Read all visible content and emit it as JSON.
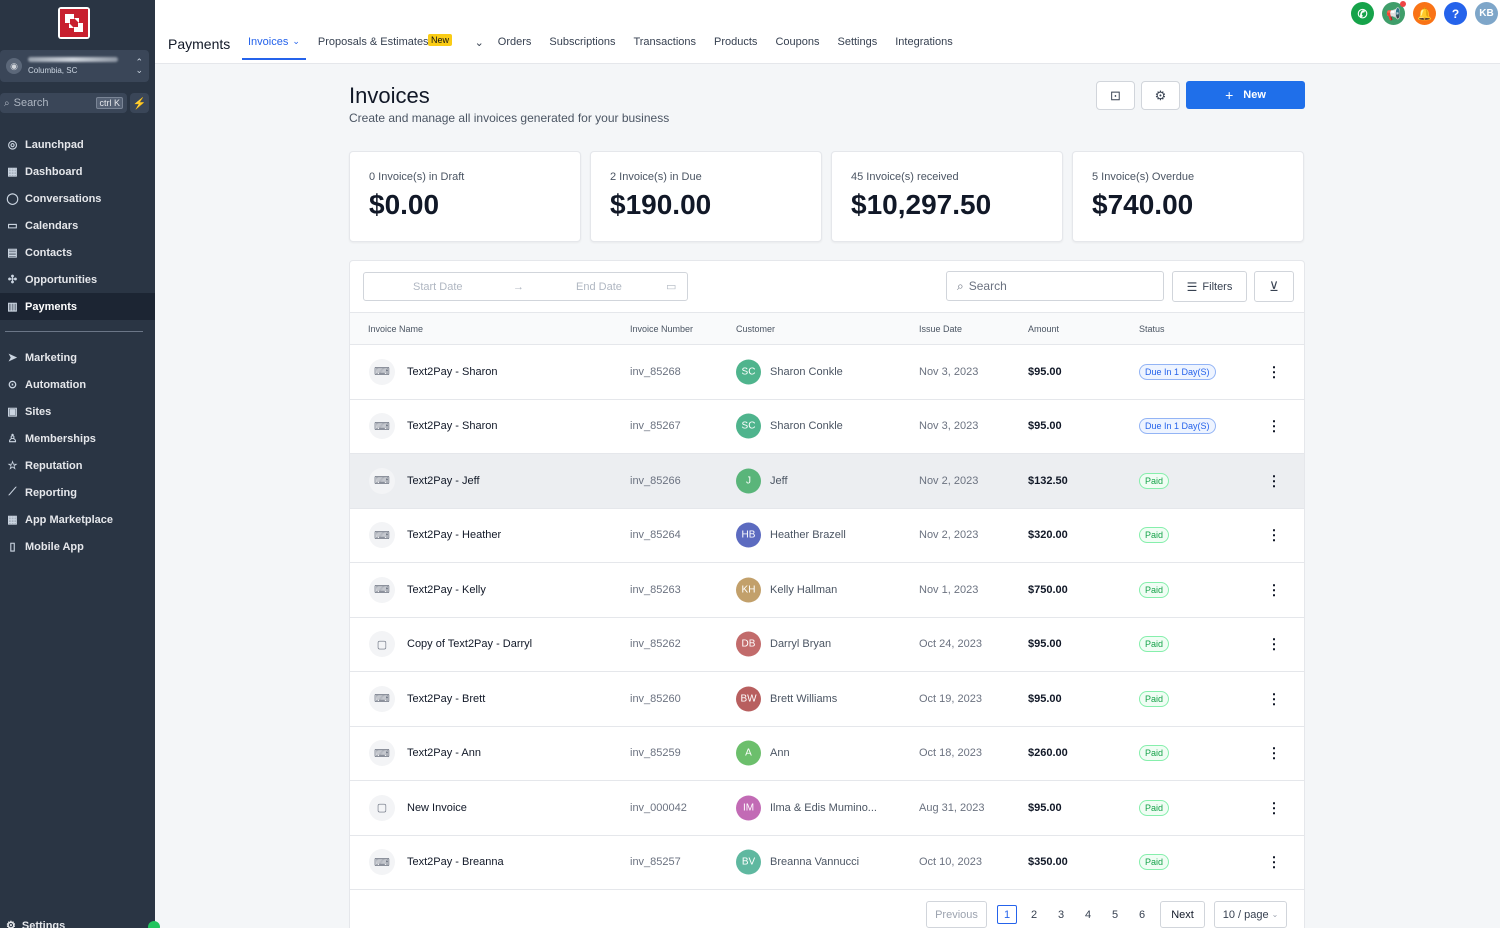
{
  "sidebar": {
    "account_location": "Columbia, SC",
    "search_placeholder": "Search",
    "search_shortcut": "ctrl K",
    "items": [
      {
        "label": "Launchpad",
        "icon": "launchpad-icon",
        "glyph": "◎"
      },
      {
        "label": "Dashboard",
        "icon": "dashboard-icon",
        "glyph": "▦"
      },
      {
        "label": "Conversations",
        "icon": "chat-icon",
        "glyph": "◯"
      },
      {
        "label": "Calendars",
        "icon": "calendar-icon",
        "glyph": "▭"
      },
      {
        "label": "Contacts",
        "icon": "contacts-icon",
        "glyph": "▤"
      },
      {
        "label": "Opportunities",
        "icon": "opportunities-icon",
        "glyph": "✣"
      },
      {
        "label": "Payments",
        "icon": "payments-icon",
        "glyph": "▥"
      }
    ],
    "items2": [
      {
        "label": "Marketing",
        "icon": "send-icon",
        "glyph": "➤"
      },
      {
        "label": "Automation",
        "icon": "automation-icon",
        "glyph": "⊙"
      },
      {
        "label": "Sites",
        "icon": "sites-icon",
        "glyph": "▣"
      },
      {
        "label": "Memberships",
        "icon": "memberships-icon",
        "glyph": "♙"
      },
      {
        "label": "Reputation",
        "icon": "star-icon",
        "glyph": "☆"
      },
      {
        "label": "Reporting",
        "icon": "chart-line-icon",
        "glyph": "⟋"
      },
      {
        "label": "App Marketplace",
        "icon": "grid-icon",
        "glyph": "▦"
      },
      {
        "label": "Mobile App",
        "icon": "mobile-icon",
        "glyph": "▯"
      }
    ],
    "settings_label": "Settings"
  },
  "topbar": {
    "section_title": "Payments",
    "tabs": [
      "Invoices",
      "Proposals & Estimates",
      "Orders",
      "Subscriptions",
      "Transactions",
      "Products",
      "Coupons",
      "Settings",
      "Integrations"
    ],
    "new_badge": "New",
    "user_initials": "KB"
  },
  "header": {
    "title": "Invoices",
    "subtitle": "Create and manage all invoices generated for your business",
    "new_button": "New"
  },
  "summary": [
    {
      "label": "0 Invoice(s) in Draft",
      "amount": "$0.00"
    },
    {
      "label": "2 Invoice(s) in Due",
      "amount": "$190.00"
    },
    {
      "label": "45 Invoice(s) received",
      "amount": "$10,297.50"
    },
    {
      "label": "5 Invoice(s) Overdue",
      "amount": "$740.00"
    }
  ],
  "filters": {
    "start_date": "Start Date",
    "end_date": "End Date",
    "search_placeholder": "Search",
    "filters_label": "Filters"
  },
  "table": {
    "columns": [
      "Invoice Name",
      "Invoice Number",
      "Customer",
      "Issue Date",
      "Amount",
      "Status"
    ],
    "rows": [
      {
        "name": "Text2Pay - Sharon",
        "number": "inv_85268",
        "initials": "SC",
        "avatar_color": "#4fb48d",
        "customer": "Sharon Conkle",
        "date": "Nov 3, 2023",
        "amount": "$95.00",
        "status": "Due In 1 Day(S)",
        "status_type": "due",
        "icon": "text2pay-icon"
      },
      {
        "name": "Text2Pay - Sharon",
        "number": "inv_85267",
        "initials": "SC",
        "avatar_color": "#4fb48d",
        "customer": "Sharon Conkle",
        "date": "Nov 3, 2023",
        "amount": "$95.00",
        "status": "Due In 1 Day(S)",
        "status_type": "due",
        "icon": "text2pay-icon"
      },
      {
        "name": "Text2Pay - Jeff",
        "number": "inv_85266",
        "initials": "J",
        "avatar_color": "#5ab57a",
        "customer": "Jeff",
        "date": "Nov 2, 2023",
        "amount": "$132.50",
        "status": "Paid",
        "status_type": "paid",
        "icon": "text2pay-icon"
      },
      {
        "name": "Text2Pay - Heather",
        "number": "inv_85264",
        "initials": "HB",
        "avatar_color": "#5c6bc0",
        "customer": "Heather Brazell",
        "date": "Nov 2, 2023",
        "amount": "$320.00",
        "status": "Paid",
        "status_type": "paid",
        "icon": "text2pay-icon"
      },
      {
        "name": "Text2Pay - Kelly",
        "number": "inv_85263",
        "initials": "KH",
        "avatar_color": "#c2a06b",
        "customer": "Kelly Hallman",
        "date": "Nov 1, 2023",
        "amount": "$750.00",
        "status": "Paid",
        "status_type": "paid",
        "icon": "text2pay-icon"
      },
      {
        "name": "Copy of Text2Pay - Darryl",
        "number": "inv_85262",
        "initials": "DB",
        "avatar_color": "#c26b6b",
        "customer": "Darryl Bryan",
        "date": "Oct 24, 2023",
        "amount": "$95.00",
        "status": "Paid",
        "status_type": "paid",
        "icon": "invoice-icon"
      },
      {
        "name": "Text2Pay - Brett",
        "number": "inv_85260",
        "initials": "BW",
        "avatar_color": "#b85f5f",
        "customer": "Brett Williams",
        "date": "Oct 19, 2023",
        "amount": "$95.00",
        "status": "Paid",
        "status_type": "paid",
        "icon": "text2pay-icon"
      },
      {
        "name": "Text2Pay - Ann",
        "number": "inv_85259",
        "initials": "A",
        "avatar_color": "#6cbf6c",
        "customer": "Ann",
        "date": "Oct 18, 2023",
        "amount": "$260.00",
        "status": "Paid",
        "status_type": "paid",
        "icon": "text2pay-icon"
      },
      {
        "name": "New Invoice",
        "number": "inv_000042",
        "initials": "IM",
        "avatar_color": "#c26bb5",
        "customer": "Ilma & Edis Mumino...",
        "date": "Aug 31, 2023",
        "amount": "$95.00",
        "status": "Paid",
        "status_type": "paid",
        "icon": "invoice-icon"
      },
      {
        "name": "Text2Pay - Breanna",
        "number": "inv_85257",
        "initials": "BV",
        "avatar_color": "#5fb8a0",
        "customer": "Breanna Vannucci",
        "date": "Oct 10, 2023",
        "amount": "$350.00",
        "status": "Paid",
        "status_type": "paid",
        "icon": "text2pay-icon"
      }
    ]
  },
  "pagination": {
    "previous": "Previous",
    "pages": [
      "1",
      "2",
      "3",
      "4",
      "5",
      "6"
    ],
    "current": "1",
    "next": "Next",
    "page_size": "10 / page"
  }
}
